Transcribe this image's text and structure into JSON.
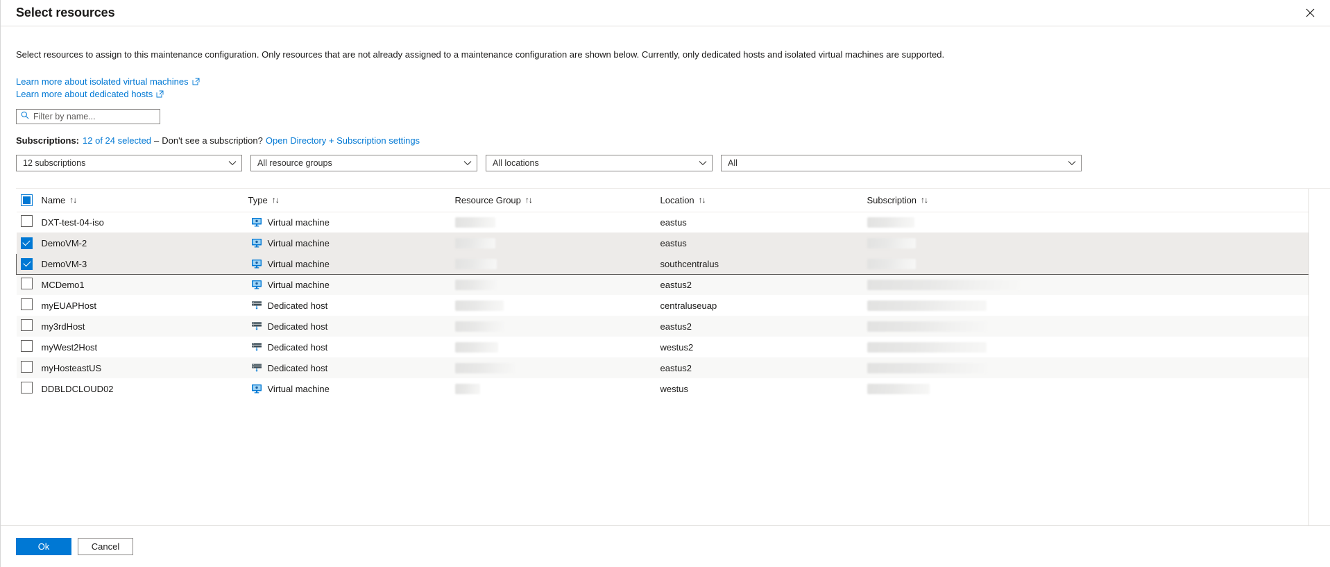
{
  "blade": {
    "title": "Select resources",
    "close_icon": "close-icon",
    "description": "Select resources to assign to this maintenance configuration. Only resources that are not already assigned to a maintenance configuration are shown below. Currently, only dedicated hosts and isolated virtual machines are supported."
  },
  "links": [
    {
      "label": "Learn more about isolated virtual machines",
      "icon": "external-link-icon"
    },
    {
      "label": "Learn more about dedicated hosts",
      "icon": "external-link-icon"
    }
  ],
  "filter": {
    "placeholder": "Filter by name...",
    "value": "",
    "icon": "search-icon"
  },
  "subscriptions_line": {
    "label": "Subscriptions:",
    "selected_link": "12 of 24 selected",
    "separator": "–",
    "question": "Don't see a subscription?",
    "settings_link": "Open Directory + Subscription settings"
  },
  "dropdowns": [
    {
      "name": "subscription-filter",
      "value": "12 subscriptions"
    },
    {
      "name": "resource-group-filter",
      "value": "All resource groups"
    },
    {
      "name": "location-filter",
      "value": "All locations"
    },
    {
      "name": "type-filter",
      "value": "All"
    }
  ],
  "table": {
    "select_all_state": "indeterminate",
    "columns": [
      {
        "key": "name",
        "label": "Name",
        "sortable": true
      },
      {
        "key": "type",
        "label": "Type",
        "sortable": true
      },
      {
        "key": "resource_group",
        "label": "Resource Group",
        "sortable": true
      },
      {
        "key": "location",
        "label": "Location",
        "sortable": true
      },
      {
        "key": "subscription",
        "label": "Subscription",
        "sortable": true
      }
    ],
    "sort_glyph": "↑↓",
    "rows": [
      {
        "name": "DXT-test-04-iso",
        "type": "Virtual machine",
        "type_icon": "virtual-machine-icon",
        "location": "eastus",
        "checked": false,
        "focused": false,
        "rg_redacted_width": 58,
        "sub_redacted_width": 68
      },
      {
        "name": "DemoVM-2",
        "type": "Virtual machine",
        "type_icon": "virtual-machine-icon",
        "location": "eastus",
        "checked": true,
        "focused": false,
        "rg_redacted_width": 58,
        "sub_redacted_width": 70
      },
      {
        "name": "DemoVM-3",
        "type": "Virtual machine",
        "type_icon": "virtual-machine-icon",
        "location": "southcentralus",
        "checked": true,
        "focused": true,
        "rg_redacted_width": 60,
        "sub_redacted_width": 70
      },
      {
        "name": "MCDemo1",
        "type": "Virtual machine",
        "type_icon": "virtual-machine-icon",
        "location": "eastus2",
        "checked": false,
        "focused": false,
        "rg_redacted_width": 60,
        "sub_redacted_width": 220
      },
      {
        "name": "myEUAPHost",
        "type": "Dedicated host",
        "type_icon": "dedicated-host-icon",
        "location": "centraluseuap",
        "checked": false,
        "focused": false,
        "rg_redacted_width": 70,
        "sub_redacted_width": 172
      },
      {
        "name": "my3rdHost",
        "type": "Dedicated host",
        "type_icon": "dedicated-host-icon",
        "location": "eastus2",
        "checked": false,
        "focused": false,
        "rg_redacted_width": 70,
        "sub_redacted_width": 172
      },
      {
        "name": "myWest2Host",
        "type": "Dedicated host",
        "type_icon": "dedicated-host-icon",
        "location": "westus2",
        "checked": false,
        "focused": false,
        "rg_redacted_width": 62,
        "sub_redacted_width": 172
      },
      {
        "name": "myHosteastUS",
        "type": "Dedicated host",
        "type_icon": "dedicated-host-icon",
        "location": "eastus2",
        "checked": false,
        "focused": false,
        "rg_redacted_width": 86,
        "sub_redacted_width": 172
      },
      {
        "name": "DDBLDCLOUD02",
        "type": "Virtual machine",
        "type_icon": "virtual-machine-icon",
        "location": "westus",
        "checked": false,
        "focused": false,
        "rg_redacted_width": 36,
        "sub_redacted_width": 90
      }
    ]
  },
  "footer": {
    "ok_label": "Ok",
    "cancel_label": "Cancel"
  },
  "colors": {
    "accent": "#0078d4",
    "link": "#0078d4",
    "selected_row": "#edebe9",
    "alt_row": "#f8f8f7",
    "text": "#1b1a19"
  }
}
